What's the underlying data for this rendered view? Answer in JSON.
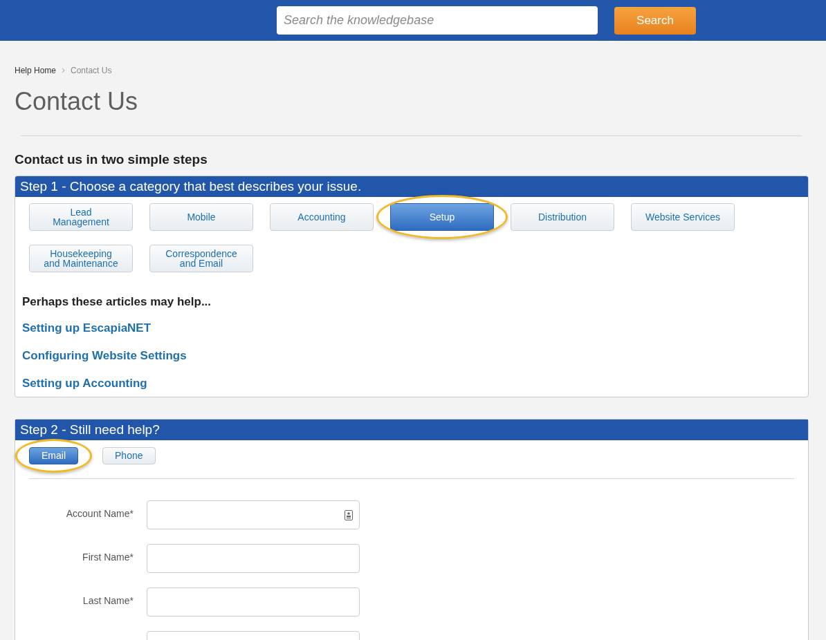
{
  "header": {
    "search": {
      "placeholder": "Search the knowledgebase"
    },
    "search_button": "Search"
  },
  "breadcrumb": [
    {
      "label": "Help Home",
      "current": false
    },
    {
      "label": "Contact Us",
      "current": true
    }
  ],
  "title": "Contact Us",
  "subtitle": "Contact us in two simple steps",
  "step1": {
    "title": "Step 1 - Choose a category that best describes your issue.",
    "categories": [
      {
        "label": "Lead\nManagement",
        "selected": false
      },
      {
        "label": "Mobile",
        "selected": false
      },
      {
        "label": "Accounting",
        "selected": false
      },
      {
        "label": "Setup",
        "selected": true
      },
      {
        "label": "Distribution",
        "selected": false
      },
      {
        "label": "Website Services",
        "selected": false
      },
      {
        "label": "Housekeeping\nand Maintenance",
        "selected": false
      },
      {
        "label": "Correspondence\nand Email",
        "selected": false
      }
    ],
    "articles_heading": "Perhaps these articles may help...",
    "articles": [
      "Setting up EscapiaNET",
      "Configuring Website Settings",
      "Setting up Accounting"
    ]
  },
  "step2": {
    "title": "Step 2 - Still need help?",
    "tabs": [
      {
        "label": "Email",
        "selected": true
      },
      {
        "label": "Phone",
        "selected": false
      }
    ],
    "fields": [
      {
        "label": "Account Name*",
        "kind": "lookup"
      },
      {
        "label": "First Name*",
        "kind": "text"
      },
      {
        "label": "Last Name*",
        "kind": "text"
      },
      {
        "kind": "text"
      }
    ]
  }
}
